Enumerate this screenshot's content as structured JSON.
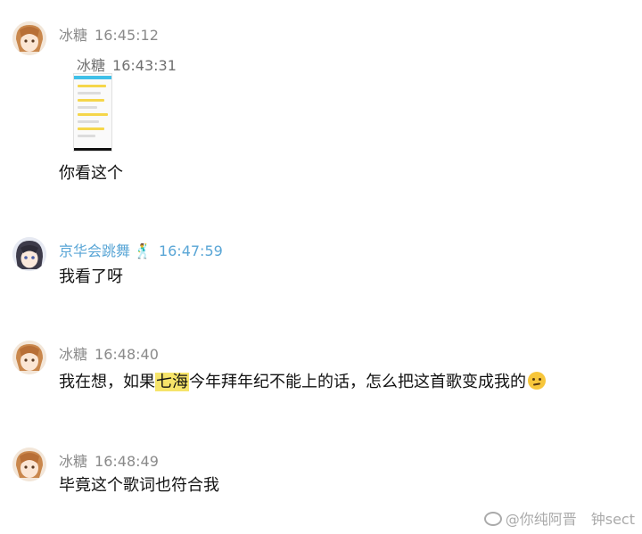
{
  "messages": [
    {
      "name": "冰糖",
      "time": "16:45:12"
    },
    {
      "name": "京华会跳舞",
      "time": "16:47:59",
      "text": "我看了呀"
    },
    {
      "name": "冰糖",
      "time": "16:48:40",
      "text_pre": "我在想，如果",
      "text_hl": "七海",
      "text_post": "今年拜年纪不能上的话，怎么把这首歌变成我的"
    },
    {
      "name": "冰糖",
      "time": "16:48:49",
      "text": "毕竟这个歌词也符合我"
    }
  ],
  "quoted": {
    "name": "冰糖",
    "time": "16:43:31"
  },
  "message1_text": "你看这个",
  "dancer_emoji": "🕺",
  "watermark": "@你纯阿晋　钟sect",
  "colors": {
    "blue_name": "#5aa6d6",
    "highlight": "#f6e46a",
    "cyan_bar": "#40c0e8"
  }
}
